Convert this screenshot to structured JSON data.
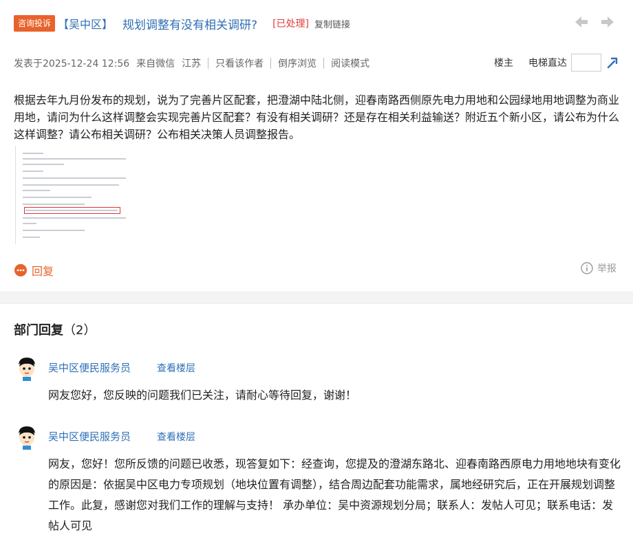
{
  "post": {
    "badge": "咨询投诉",
    "district": "【吴中区】",
    "title": "规划调整有没有相关调研?",
    "status": "[已处理]",
    "copy_link": "复制链接",
    "meta": {
      "posted_at": "发表于2025-12-24 12:56",
      "source": "来自微信",
      "location": "江苏",
      "only_author": "只看该作者",
      "reverse": "倒序浏览",
      "reading_mode": "阅读模式",
      "floor_owner": "楼主",
      "elevator": "电梯直达"
    },
    "content": "根据去年九月份发布的规划，说为了完善片区配套，把澄湖中陆北侧，迎春南路西侧原先电力用地和公园绿地用地调整为商业用地，请问为什么这样调整会实现完善片区配套？有没有相关调研？还是存在相关利益输送？附近五个新小区，请公布为什么这样调整？请公布相关调研？公布相关决策人员调整报告。",
    "reply_label": "回复",
    "report_label": "举报"
  },
  "replies_section": {
    "title": "部门回复",
    "count": "（2）"
  },
  "replies": [
    {
      "name": "吴中区便民服务员",
      "view_floor": "查看楼层",
      "text": "网友您好，您反映的问题我们已关注，请耐心等待回复，谢谢！"
    },
    {
      "name": "吴中区便民服务员",
      "view_floor": "查看楼层",
      "text": "网友，您好！您所反馈的问题已收悉，现答复如下：经查询，您提及的澄湖东路北、迎春南路西原电力用地地块有变化的原因是：依据吴中区电力专项规划（地块位置有调整），结合周边配套功能需求，属地经研究后，正在开展规划调整工作。此复，感谢您对我们工作的理解与支持！ 承办单位：吴中资源规划分局；联系人：发帖人可见；联系电话：发帖人可见"
    }
  ],
  "colors": {
    "accent_orange": "#e8632b",
    "link_blue": "#2f6fb5",
    "status_red": "#e23b3b"
  }
}
